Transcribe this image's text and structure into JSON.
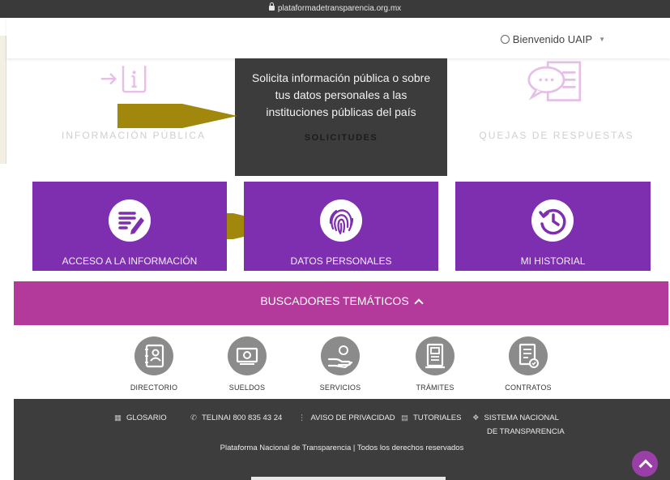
{
  "browser": {
    "url": "plataformadetransparencia.org.mx"
  },
  "header": {
    "welcome": "Bienvenido UAIP"
  },
  "top_cards": {
    "informacion": "INFORMACIÓN PÚBLICA",
    "quejas": "QUEJAS DE RESPUESTAS"
  },
  "tooltip": {
    "text": "Solicita información pública o sobre tus datos personales a las instituciones públicas del país",
    "section": "SOLICITUDES"
  },
  "tiles": {
    "acceso": "ACCESO A LA INFORMACIÓN",
    "datos": "DATOS PERSONALES",
    "historial": "MI HISTORIAL"
  },
  "buscadores": {
    "label": "BUSCADORES TEMÁTICOS"
  },
  "themes": {
    "directorio": "DIRECTORIO",
    "sueldos": "SUELDOS",
    "servicios": "SERVICIOS",
    "tramites": "TRÁMITES",
    "contratos": "CONTRATOS"
  },
  "footer": {
    "glosario": "GLOSARIO",
    "telinai": "TELINAI 800 835 43 24",
    "aviso": "AVISO DE PRIVACIDAD",
    "tutoriales": "TUTORIALES",
    "sistema_1": "SISTEMA NACIONAL",
    "sistema_2": "DE TRANSPARENCIA",
    "copyright": "Plataforma Nacional de Transparencia | Todos los derechos reservados"
  },
  "colors": {
    "purple": "#7e2fb0",
    "magenta": "#b33a9b",
    "dark": "#3c3c3c",
    "arrow": "#9c8200"
  }
}
